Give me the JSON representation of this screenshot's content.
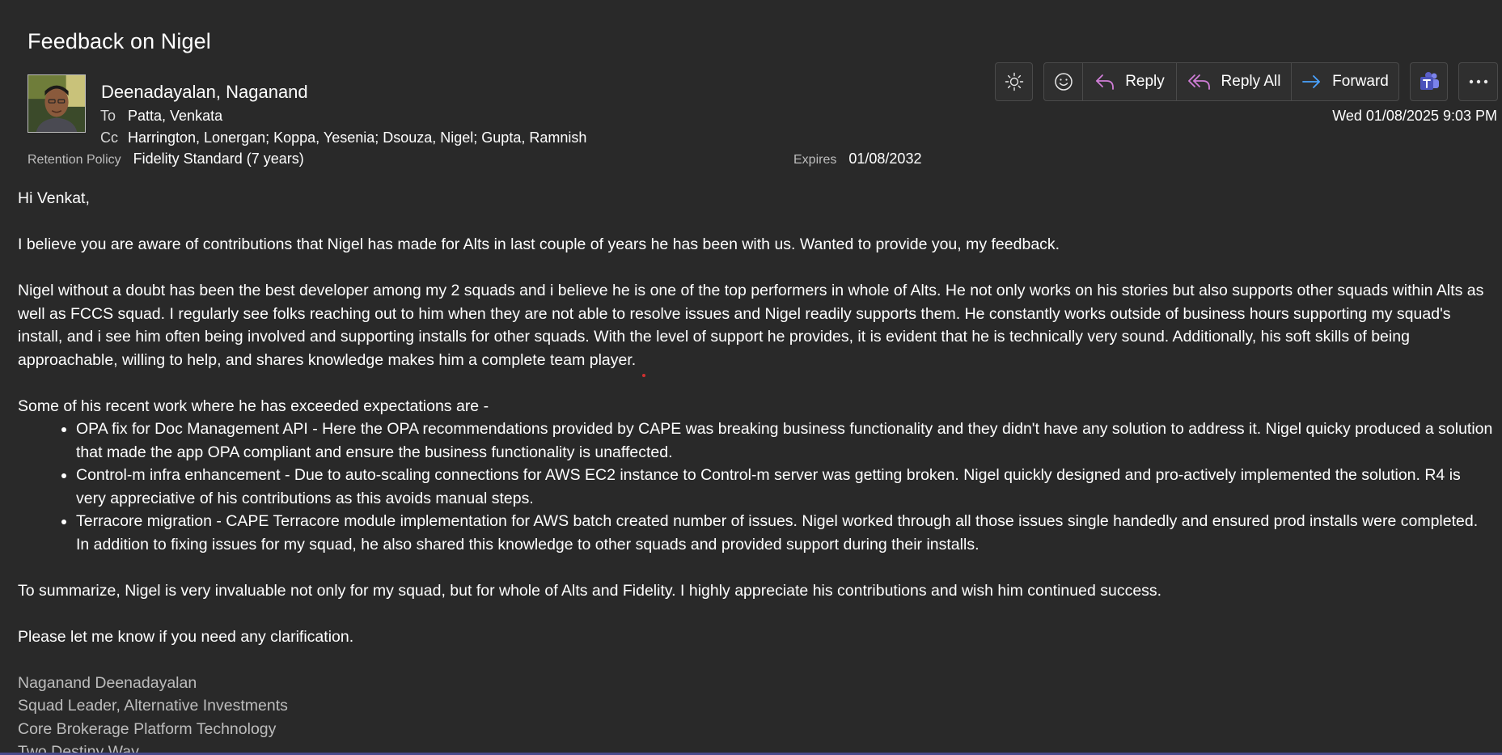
{
  "email": {
    "subject": "Feedback on Nigel",
    "sender": "Deenadayalan, Naganand",
    "to_label": "To",
    "to": "Patta, Venkata",
    "cc_label": "Cc",
    "cc": "Harrington, Lonergan; Koppa, Yesenia; Dsouza, Nigel; Gupta, Ramnish",
    "retention_label": "Retention Policy",
    "retention_value": "Fidelity Standard (7 years)",
    "expires_label": "Expires",
    "expires_value": "01/08/2032",
    "date": "Wed 01/08/2025 9:03 PM"
  },
  "toolbar": {
    "reply_label": "Reply",
    "reply_all_label": "Reply All",
    "forward_label": "Forward"
  },
  "body": {
    "greeting": "Hi Venkat,",
    "para1": "I believe you are aware of contributions that Nigel has made for Alts in last couple of years he has been with us. Wanted to provide you, my feedback.",
    "para2": "Nigel without a doubt has been the best developer among my 2 squads and i believe he is one of the top performers in whole of Alts. He not only works on his stories but also supports other squads within Alts as well as FCCS squad. I regularly see folks reaching out to him when they are not able to resolve issues and Nigel readily supports them. He constantly works outside of business hours supporting my squad's install, and i see him often being involved and supporting installs for other squads. With the level of support he provides, it is evident that he is technically very sound. Additionally, his soft skills of being approachable, willing to help, and shares knowledge makes him a complete team player.",
    "list_intro": "Some of his recent work where he has exceeded expectations are -",
    "bullets": [
      "OPA fix for Doc Management API - Here the OPA recommendations provided by CAPE was breaking business functionality and they didn't have any solution to address it. Nigel quicky produced a solution that made the app OPA compliant and ensure the business functionality is unaffected.",
      "Control-m infra enhancement - Due to auto-scaling connections for AWS EC2 instance to Control-m server was getting broken. Nigel quickly designed and pro-actively implemented the solution. R4 is very appreciative of his contributions as this avoids manual steps.",
      "Terracore migration - CAPE Terracore module implementation for AWS batch created number of issues. Nigel worked through all those issues single handedly and ensured prod installs were completed. In addition to fixing issues for my squad, he also shared this knowledge to other squads and provided support during their installs."
    ],
    "summary": "To summarize, Nigel is very invaluable not only for my squad, but for whole of Alts and Fidelity. I highly appreciate his contributions and wish him continued success.",
    "closing": "Please let me know if you need any clarification.",
    "signature": [
      "Naganand Deenadayalan",
      "Squad Leader, Alternative Investments",
      "Core Brokerage Platform Technology",
      "Two Destiny Way"
    ]
  },
  "icons": {
    "theme": "sun-icon",
    "emoji": "smiley-icon",
    "reply": "reply-arrow-icon",
    "reply_all": "reply-all-arrow-icon",
    "forward": "forward-arrow-icon",
    "teams": "teams-icon",
    "more": "more-ellipsis-icon"
  },
  "colors": {
    "background": "#292929",
    "reply_accent": "#d17ed8",
    "forward_accent": "#4aa3ff",
    "teams_accent": "#6b6fd6",
    "muted_text": "#bdbdbd"
  }
}
